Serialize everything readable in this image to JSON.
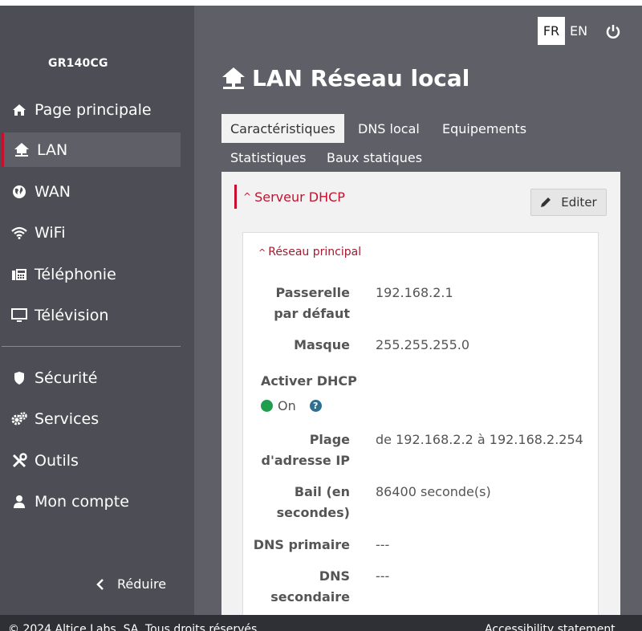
{
  "brand": "GR140CG",
  "sidebar": {
    "items": [
      {
        "label": "Page principale",
        "icon": "home-icon"
      },
      {
        "label": "LAN",
        "icon": "lan-home-icon",
        "active": true
      },
      {
        "label": "WAN",
        "icon": "globe-icon"
      },
      {
        "label": "WiFi",
        "icon": "wifi-icon"
      },
      {
        "label": "Téléphonie",
        "icon": "fax-phone-icon"
      },
      {
        "label": "Télévision",
        "icon": "monitor-icon"
      },
      {
        "label": "Sécurité",
        "icon": "shield-icon"
      },
      {
        "label": "Services",
        "icon": "gears-icon"
      },
      {
        "label": "Outils",
        "icon": "tools-icon"
      },
      {
        "label": "Mon compte",
        "icon": "user-icon"
      }
    ],
    "reduce_label": "Réduire"
  },
  "header": {
    "lang_fr": "FR",
    "lang_en": "EN",
    "active_lang": "FR"
  },
  "page": {
    "title": "LAN Réseau local"
  },
  "tabs": [
    {
      "label": "Caractéristiques",
      "active": true
    },
    {
      "label": "DNS local"
    },
    {
      "label": "Equipements"
    },
    {
      "label": "Statistiques"
    },
    {
      "label": "Baux statiques"
    }
  ],
  "section": {
    "title": "Serveur DHCP",
    "edit_label": "Editer",
    "subsection_title": "Réseau principal",
    "fields": {
      "gateway_label_1": "Passerelle",
      "gateway_label_2": "par défaut",
      "gateway_value": "192.168.2.1",
      "mask_label": "Masque",
      "mask_value": "255.255.255.0",
      "dhcp_label": "Activer DHCP",
      "dhcp_value": "On",
      "range_label_1": "Plage",
      "range_label_2": "d'adresse IP",
      "range_value": "de 192.168.2.2 à 192.168.2.254",
      "lease_label_1": "Bail (en",
      "lease_label_2": "secondes)",
      "lease_value": "86400 seconde(s)",
      "dns1_label": "DNS primaire",
      "dns1_value": "---",
      "dns2_label_1": "DNS",
      "dns2_label_2": "secondaire",
      "dns2_value": "---"
    }
  },
  "footer": {
    "copyright": "© 2024 Altice Labs, SA. Tous droits réservés.",
    "accessibility": "Accessibility statement"
  },
  "colors": {
    "sidebar_bg": "#4d4e55",
    "main_bg": "#5e5f67",
    "accent_red": "#c8102e",
    "status_green": "#1e9e4e",
    "help_blue": "#2f6f8f"
  }
}
